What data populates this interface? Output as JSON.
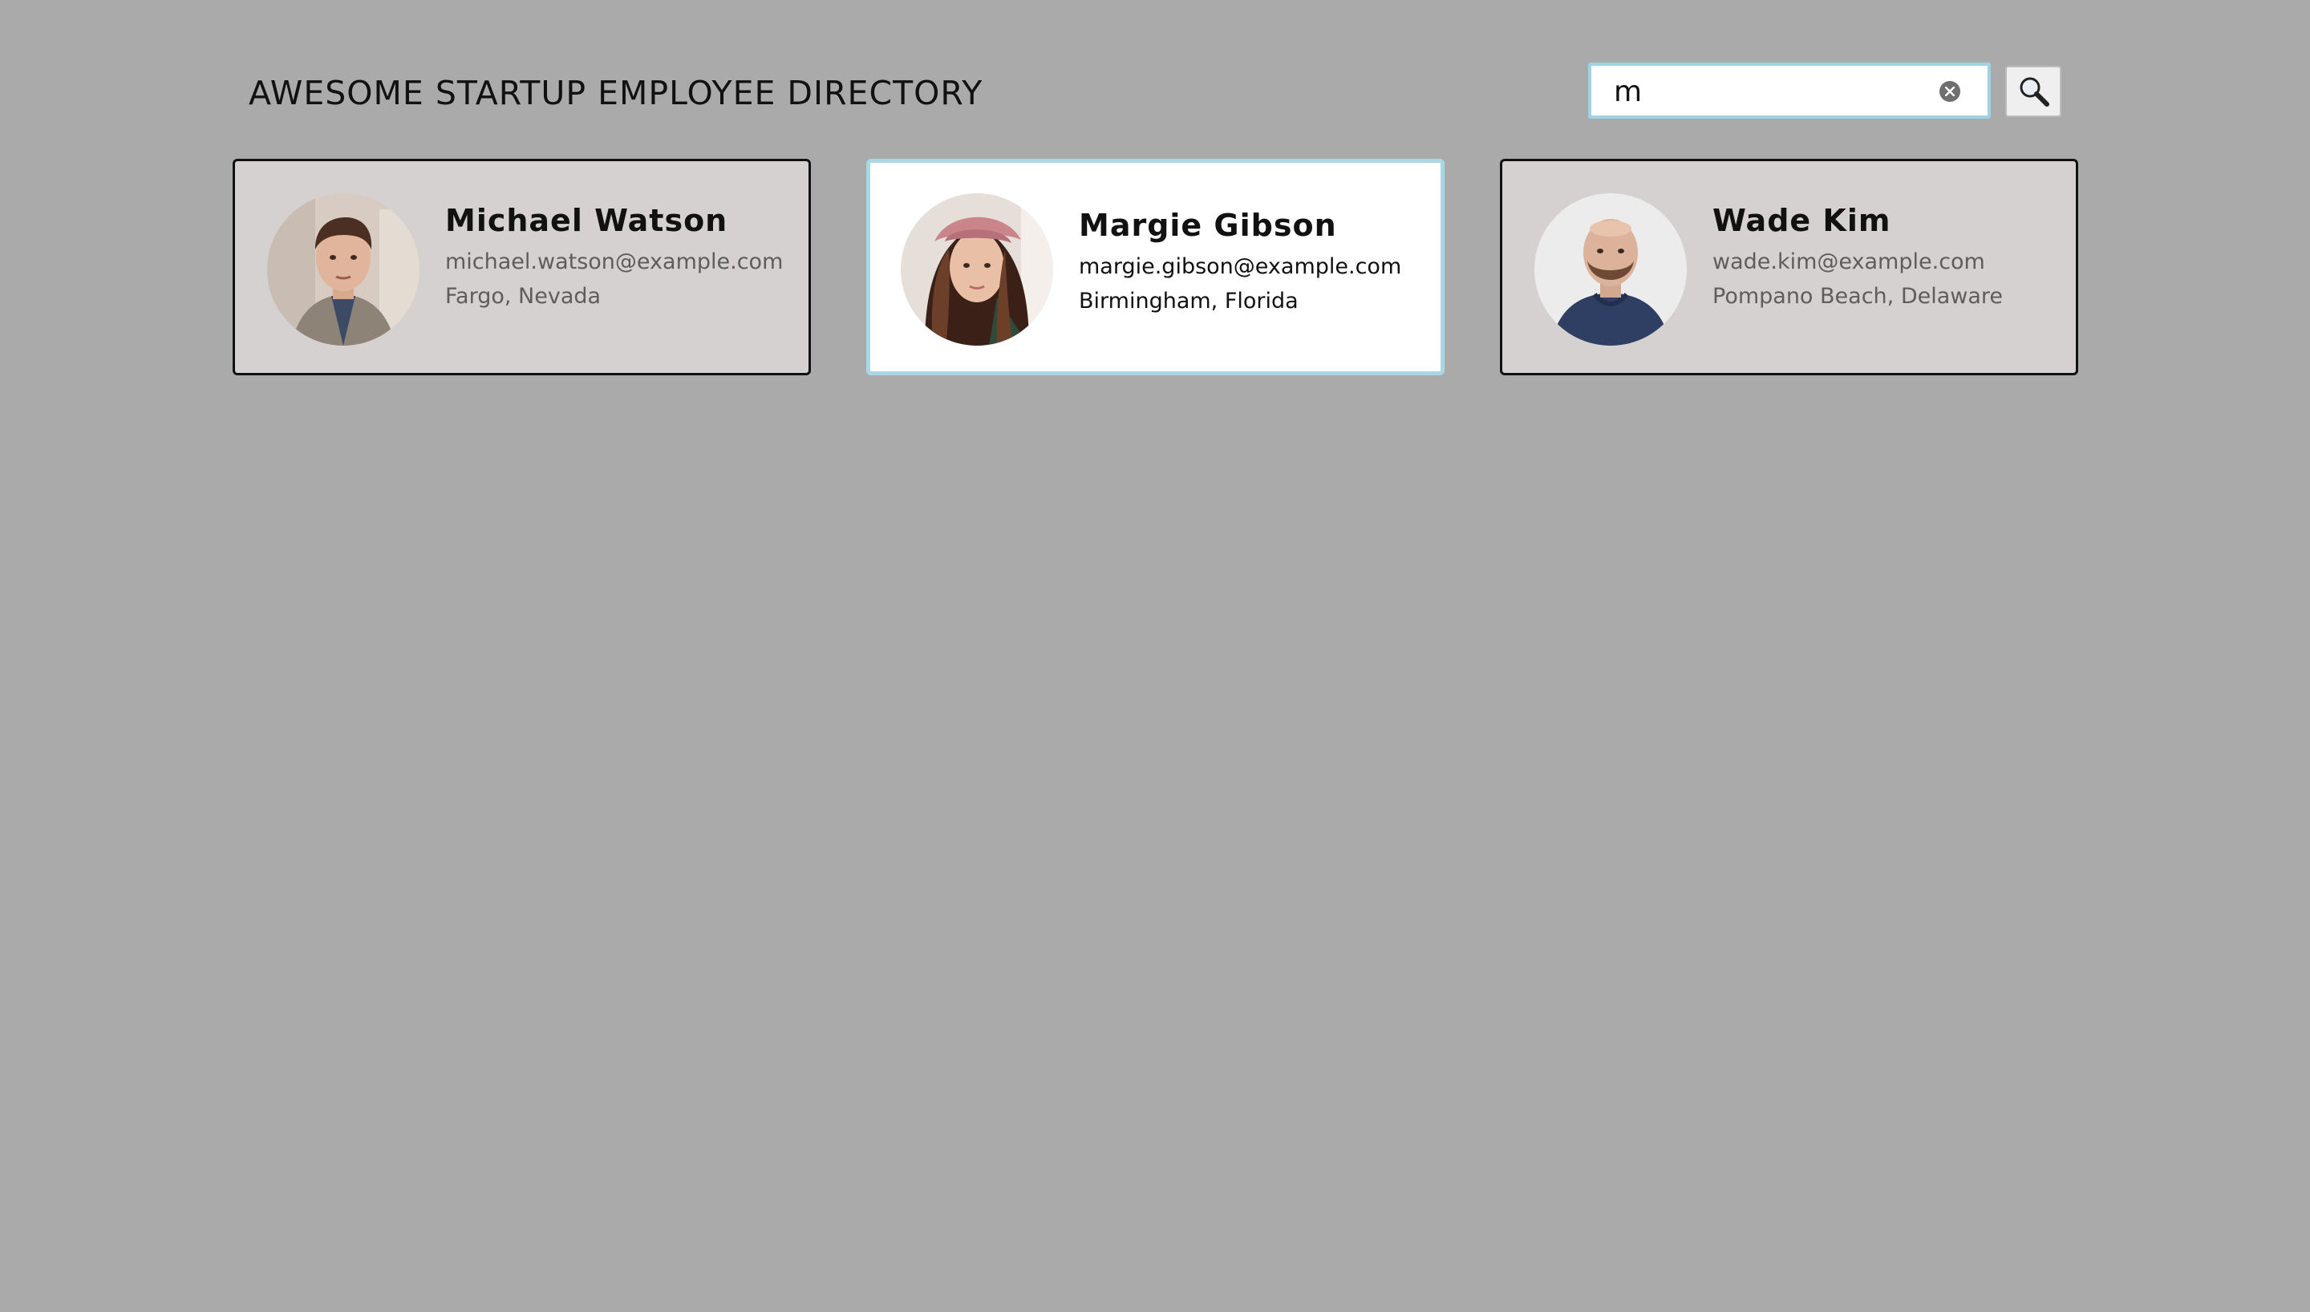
{
  "header": {
    "title": "AWESOME STARTUP EMPLOYEE DIRECTORY",
    "search": {
      "value": "m",
      "placeholder": "",
      "clear_icon": "close-circle-icon",
      "button_icon": "magnifier-icon"
    }
  },
  "employees": [
    {
      "name": "Michael Watson",
      "email": "michael.watson@example.com",
      "location": "Fargo, Nevada",
      "selected": false
    },
    {
      "name": "Margie Gibson",
      "email": "margie.gibson@example.com",
      "location": "Birmingham, Florida",
      "selected": true
    },
    {
      "name": "Wade Kim",
      "email": "wade.kim@example.com",
      "location": "Pompano Beach, Delaware",
      "selected": false
    }
  ],
  "colors": {
    "background": "#aaaaaa",
    "card": "#d6d1d1",
    "card_selected": "#ffffff",
    "selected_border": "#a8d7e6",
    "search_border": "#9fd3e3"
  }
}
